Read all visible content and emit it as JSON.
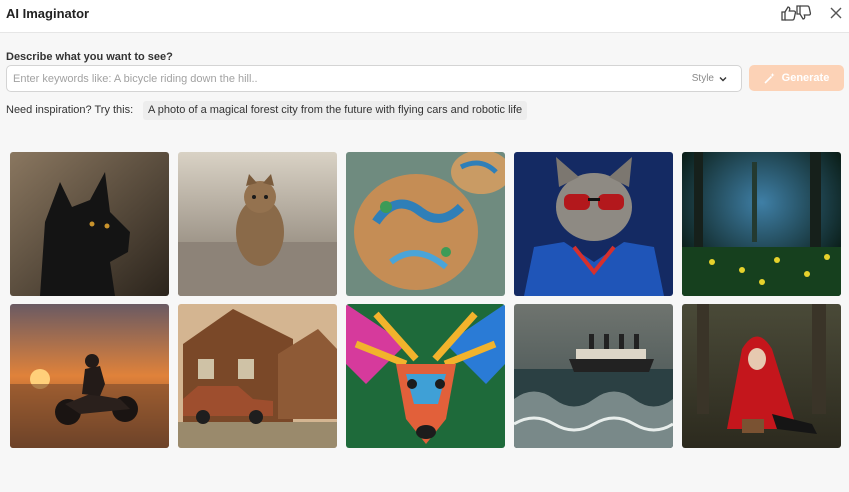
{
  "app": {
    "title": "AI Imaginator"
  },
  "header": {
    "icons": [
      "thumbs-up-icon",
      "thumbs-down-icon",
      "close-icon"
    ]
  },
  "prompt": {
    "label": "Describe what you want to see?",
    "placeholder": "Enter keywords like: A bicycle riding down the hill..",
    "value": "",
    "style_label": "Style",
    "generate_label": "Generate"
  },
  "inspiration": {
    "label": "Need inspiration? Try this:",
    "suggestion": "A photo of a magical forest city from the future with flying cars and robotic life"
  },
  "colors": {
    "generate_bg": "#fcd2b6",
    "accent": "#f8a36d"
  },
  "gallery": {
    "images": [
      {
        "name": "black-wolf-image"
      },
      {
        "name": "tabby-cat-walking-image"
      },
      {
        "name": "decorated-cookies-image"
      },
      {
        "name": "cat-with-sunglasses-image"
      },
      {
        "name": "glowing-forest-image"
      },
      {
        "name": "motorcycle-sunset-image"
      },
      {
        "name": "wooden-house-vintage-car-image"
      },
      {
        "name": "colorful-deer-image"
      },
      {
        "name": "ship-stormy-sea-image"
      },
      {
        "name": "red-riding-hood-image"
      }
    ]
  }
}
